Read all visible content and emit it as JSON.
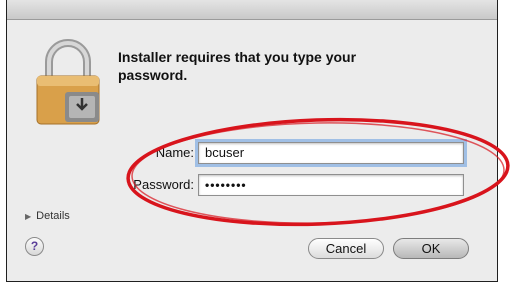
{
  "dialog": {
    "message": "Installer requires that you type your password.",
    "name_label": "Name:",
    "name_value": "bcuser",
    "password_label": "Password:",
    "password_value": "••••••••",
    "details_label": "Details",
    "help_label": "?",
    "cancel_label": "Cancel",
    "ok_label": "OK"
  },
  "icons": {
    "dialog_icon": "lock-icon",
    "details_icon": "disclosure-triangle-icon",
    "help_icon": "help-icon"
  },
  "colors": {
    "annotation": "#d8141c",
    "focus_ring": "#639ae0",
    "lock_body": "#d9a04a"
  }
}
